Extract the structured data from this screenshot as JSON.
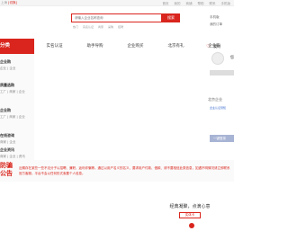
{
  "topbar": {
    "location_prefix": "上海",
    "location_red": "[切换]",
    "links": [
      "首页",
      "我的",
      "商铺",
      "帮助",
      "联系",
      "手机版"
    ]
  },
  "search": {
    "placeholder": "请输入企业名称查询",
    "button_label": "搜索",
    "hot_words": [
      "热门",
      "实名认证",
      "商家",
      "采购",
      "招聘"
    ]
  },
  "side_top": {
    "line1": "手机版",
    "line2": "我的订单"
  },
  "category": {
    "title": "分类"
  },
  "nav": {
    "items": [
      "实名认证",
      "助手导购",
      "企业购买",
      "北京有礼",
      "企业购"
    ]
  },
  "sidebar": {
    "groups": [
      {
        "title": "企业购",
        "sub": "企业 | 企业"
      },
      {
        "title": "质量选购",
        "sub": "工厂 | 商家 | 企业"
      },
      {
        "title": "企业购",
        "sub": "工厂 | 商家 | 企业"
      },
      {
        "title": "在线咨询",
        "sub": "商家 | 企业"
      },
      {
        "title": "企业资讯",
        "sub": "商家 | 企业 | 资讯"
      }
    ]
  },
  "user_panel": {
    "heart": "♡",
    "head_text": "我的",
    "username": "您",
    "company_label": "北京企业",
    "note": "企业认证须知",
    "submit_label": "一键登录"
  },
  "notice": {
    "label": "防骗公告",
    "text": "近期存在某些一些不法分子以招聘、兼职、返利诈骗等。通过以用户名义的名义、要求用户付款、借款、请不要相信此类信息，如遇不明情况请立即联系官方客服。平台不会以任何形式索要个人信息。"
  },
  "promo": {
    "slogan": "经典凝聚，点滴心意",
    "tag": "实体卡"
  }
}
